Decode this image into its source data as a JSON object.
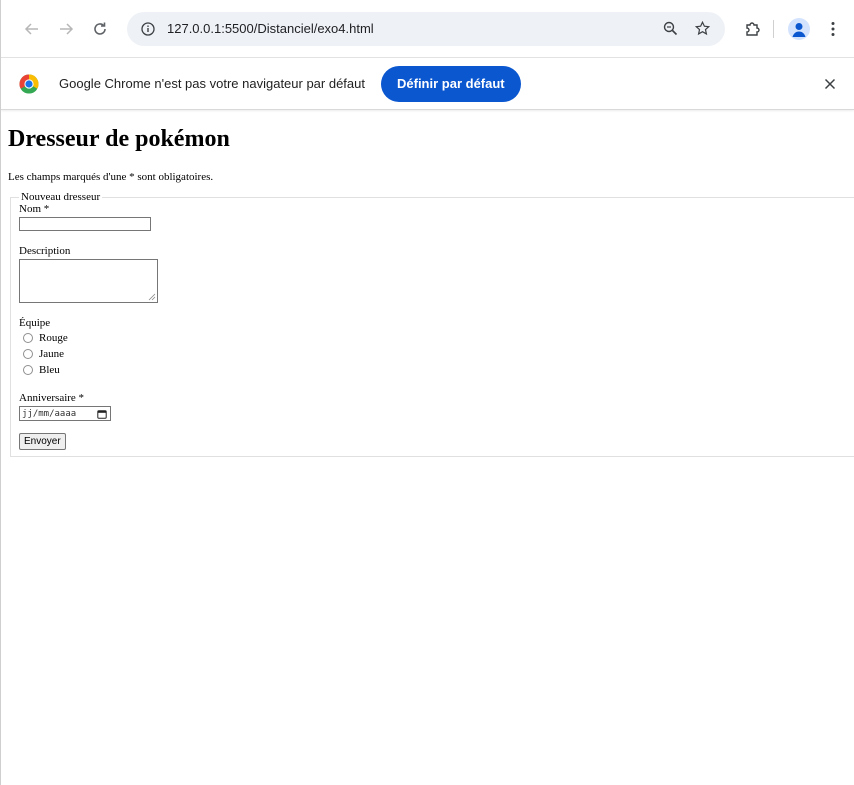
{
  "browser": {
    "url": "127.0.0.1:5500/Distanciel/exo4.html"
  },
  "infobar": {
    "message": "Google Chrome n'est pas votre navigateur par défaut",
    "button_label": "Définir par défaut"
  },
  "page": {
    "title": "Dresseur de pokémon",
    "note": "Les champs marqués d'une * sont obligatoires.",
    "form": {
      "legend": "Nouveau dresseur",
      "name_label": "Nom *",
      "name_value": "",
      "description_label": "Description",
      "description_value": "",
      "team_label": "Équipe",
      "team_options": [
        "Rouge",
        "Jaune",
        "Bleu"
      ],
      "birthday_label": "Anniversaire *",
      "birthday_placeholder": "jj/mm/aaaa",
      "submit_label": "Envoyer"
    }
  },
  "icons": {
    "back": "back-arrow-icon",
    "forward": "forward-arrow-icon",
    "reload": "reload-icon",
    "site_info": "site-info-icon",
    "zoom": "zoom-icon",
    "bookmark": "star-icon",
    "extensions": "puzzle-icon",
    "profile": "profile-avatar-icon",
    "menu": "kebab-menu-icon",
    "close": "close-icon"
  },
  "colors": {
    "primary_button": "#0b57d0",
    "omnibox_bg": "#eef1f6"
  }
}
